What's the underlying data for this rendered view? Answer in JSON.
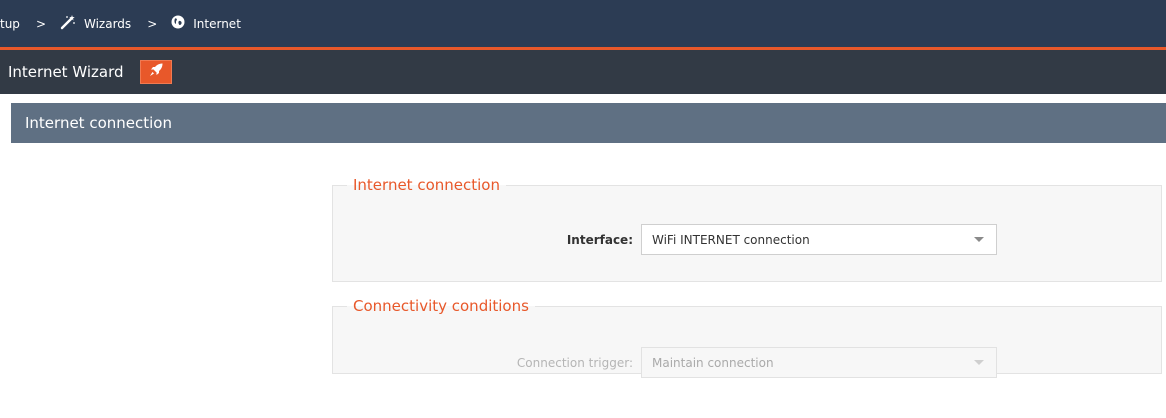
{
  "breadcrumb": {
    "items": [
      {
        "label": "tup",
        "icon": null
      },
      {
        "label": "Wizards",
        "icon": "magic-wand-icon"
      },
      {
        "label": "Internet",
        "icon": "globe-icon"
      }
    ],
    "separator": ">"
  },
  "wizard": {
    "title": "Internet Wizard",
    "launch_icon": "rocket-icon"
  },
  "section": {
    "title": "Internet connection"
  },
  "groups": {
    "internet": {
      "legend": "Internet connection",
      "interface_label": "Interface:",
      "interface_value": "WiFi INTERNET connection"
    },
    "connectivity": {
      "legend": "Connectivity conditions",
      "trigger_label": "Connection trigger:",
      "trigger_value": "Maintain connection"
    }
  },
  "colors": {
    "accent": "#e8582a",
    "breadcrumb_bg": "#2c3c54",
    "toolbar_bg": "#323a45",
    "section_bg": "#5f7083"
  }
}
